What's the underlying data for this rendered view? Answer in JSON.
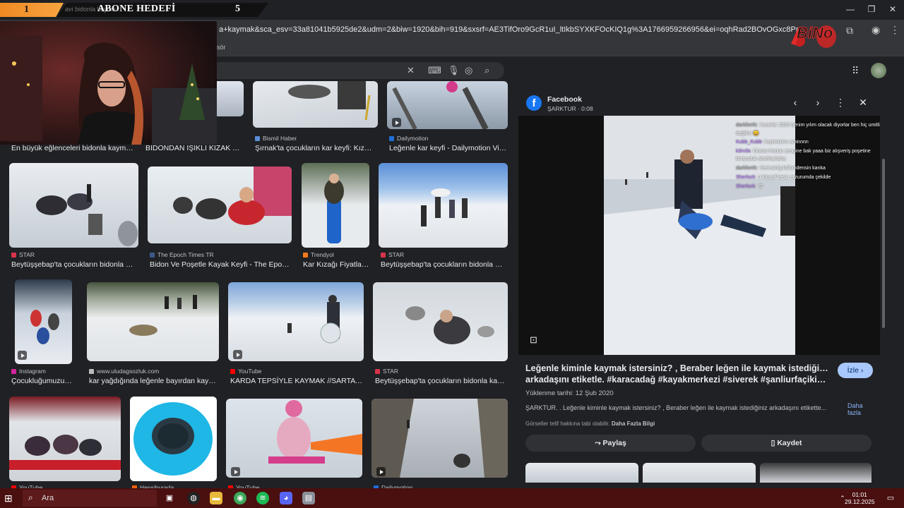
{
  "overlay": {
    "left_number": "1",
    "ghost_text": "avi bidonla kayma",
    "goal_label": "ABONE HEDEFİ",
    "goal_number": "5"
  },
  "browser": {
    "url": "a+kaymak&sca_esv=33a81041b5925de2&udm=2&biw=1920&bih=919&sxsrf=AE3TifOro9GcR1uI_ltIkbSYXKFOcKIQ1g%3A1766959266956&ei=oqhRad2BOvOGxc8PnY_e-Ag&ved=0ahUKEwjd2sGbpO...",
    "bookmark_fragment": "lasör",
    "logo_text": "BiNo"
  },
  "results": [
    {
      "source": "",
      "caption": "En büyük eğlenceleri bidonla kaymak ..."
    },
    {
      "source": "",
      "caption": "BIDONDAN IŞIKLI KIZAK YA..."
    },
    {
      "source": "Bismil Haber",
      "caption": "Şırnak'ta çocukların kar keyfi: Kızak v..."
    },
    {
      "source": "Dailymotion",
      "caption": "Leğenle kar keyfi - Dailymotion Video"
    },
    {
      "source": "STAR",
      "caption": "Beytüşşebap'ta çocukların bidonla kay..."
    },
    {
      "source": "The Epoch Times TR",
      "caption": "Bidon Ve Poşetle Kayak Keyfi - The Epoch ..."
    },
    {
      "source": "Trendyol",
      "caption": "Kar Kızağı Fiyatları ..."
    },
    {
      "source": "STAR",
      "caption": "Beytüşşebap'ta çocukların bidonla kay..."
    },
    {
      "source": "Instagram",
      "caption": "Çocukluğumuzun ..."
    },
    {
      "source": "www.uludagsozluk.com",
      "caption": "kar yağdığında leğenle bayırdan kayma..."
    },
    {
      "source": "YouTube",
      "caption": "KARDA TEPSİYLE KAYMAK //SARTAVU..."
    },
    {
      "source": "STAR",
      "caption": "Beytüşşebap'ta çocukların bidonla kayak ..."
    },
    {
      "source": "YouTube",
      "caption": ""
    },
    {
      "source": "Hepsiburada",
      "caption": ""
    },
    {
      "source": "YouTube",
      "caption": ""
    },
    {
      "source": "Dailymotion",
      "caption": ""
    }
  ],
  "panel": {
    "site": "Facebook",
    "subtitle": "ŞARKTUR · 0:08",
    "title_line1": "Leğenle kiminle kaymak istersiniz? , Beraber leğen ile kaymak istediğiniz",
    "title_line2": "arkadaşını etiketle. #karacadağ #kayakmerkezi #siverek #şanliurfaçikişlturlar...",
    "watch_label": "İzle ›",
    "upload_date": "Yüklenme tarihi: 12 Şub 2020",
    "description": "ŞARKTUR. . Leğenle kiminle kaymak istersiniz? , Beraber leğen ile kaymak istediğiniz arkadaşını etikette...",
    "more_label": "Daha fazla",
    "copyright": "Görseller telif hakkına tabi olabilir.",
    "copyright_link": "Daha Fazla Bilgi",
    "share_label": "Paylaş",
    "save_label": "Kaydet"
  },
  "chat": [
    {
      "user": "darklionfc",
      "msg": ": İnsanlar 2026 benim yılım olacak diyorlar ben hiç umitli"
    },
    {
      "user": "",
      "msg": "değilim 😄"
    },
    {
      "user": "Kubb_Kubb",
      "msg": ": hepimizinn aminnnn"
    },
    {
      "user": "k3rv3s",
      "msg": ": Ooooo hoooo zengine bak yaaa biz alışveriş poşetine"
    },
    {
      "user": "",
      "msg": "biniyoduk ahahhahaha"
    },
    {
      "user": "darklionfc",
      "msg": ": Serinsinlg bölümdensin kanka"
    },
    {
      "user": "Sherlock",
      "msg": ": o fotoraf kesin erzurumda çekilde"
    },
    {
      "user": "Sherlock",
      "msg": ": :D"
    }
  ],
  "taskbar": {
    "search_placeholder": "Ara",
    "time": "01:01",
    "date": "29.12.2025"
  },
  "colors": {
    "page_bg": "#202124",
    "taskbar": "#4a0f0f",
    "accent_button": "#a8c7fa",
    "banner_orange": "#f08a24"
  }
}
